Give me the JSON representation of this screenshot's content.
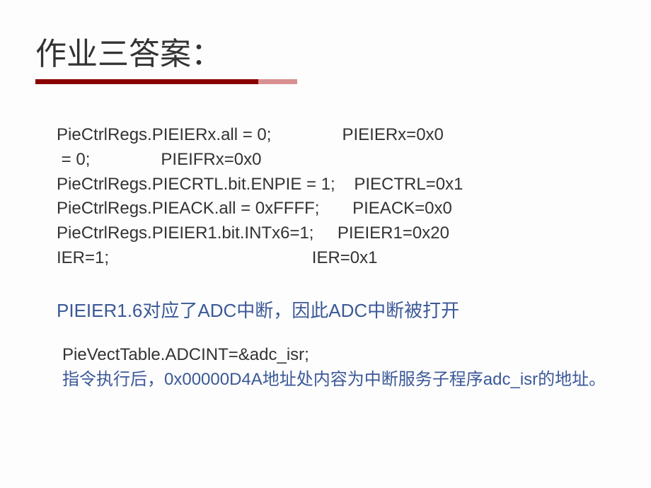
{
  "title": "作业三答案：",
  "code_lines": {
    "l1_left": "PieCtrlRegs.PIEIERx.all = 0;",
    "l1_right": "PIEIERx=0x0",
    "l2_left": " = 0;",
    "l2_right": "PIEIFRx=0x0",
    "l3_left": "PieCtrlRegs.PIECRTL.bit.ENPIE = 1;",
    "l3_right": "PIECTRL=0x1",
    "l4_left": "PieCtrlRegs.PIEACK.all = 0xFFFF;",
    "l4_right": "PIEACK=0x0",
    "l5_left": "PieCtrlRegs.PIEIER1.bit.INTx6=1;",
    "l5_right": "PIEIER1=0x20",
    "l6_left": "IER=1;",
    "l6_right": "IER=0x1"
  },
  "note1": "PIEIER1.6对应了ADC中断，因此ADC中断被打开",
  "code2": "PieVectTable.ADCINT=&adc_isr;",
  "explain": "指令执行后，0x00000D4A地址处内容为中断服务子程序adc_isr的地址。"
}
